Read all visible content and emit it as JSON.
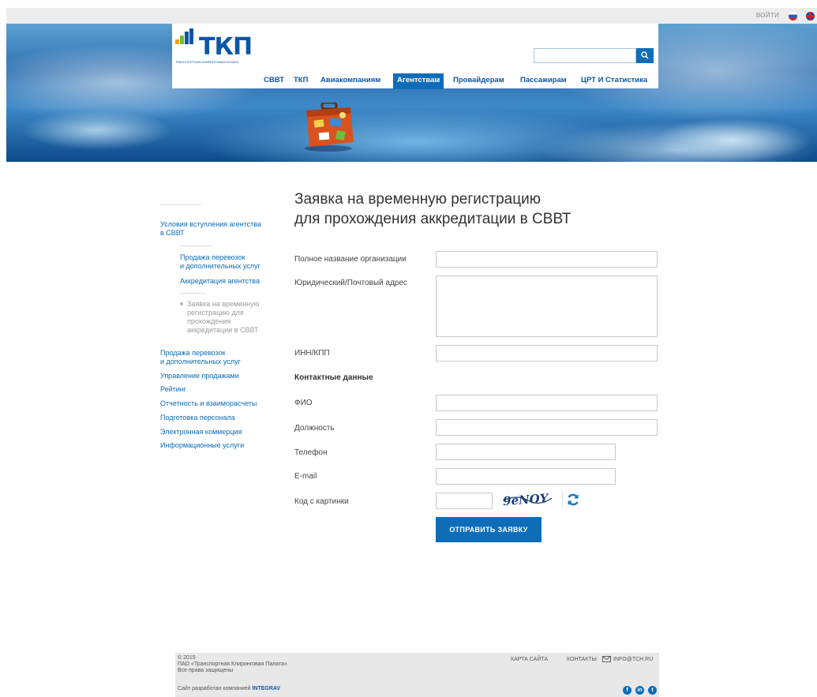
{
  "topbar": {
    "login": "войти"
  },
  "logo": {
    "text": "ТКП",
    "subtitle": "Транспортная Клиринговая Палата"
  },
  "nav": {
    "items": [
      "СВВТ",
      "ТКП",
      "Авиакомпаниям",
      "Агентствам",
      "Провайдерам",
      "Пассажирам",
      "ЦРТ И Статистика"
    ],
    "active": "Агентствам"
  },
  "sidebar": {
    "top_link": [
      "Условия вступления агентства",
      "в СВВТ"
    ],
    "sub1": [
      "Продажа перевозок",
      "и дополнительных услуг"
    ],
    "sub2": "Аккредитация агентства",
    "current": [
      "Заявка на временную",
      "регистрацию для",
      "прохождения",
      "аккредитации в СВВТ"
    ],
    "links": [
      [
        "Продажа перевозок",
        "и дополнительных услуг"
      ],
      [
        "Управление продажами"
      ],
      [
        "Рейтинг"
      ],
      [
        "Отчетность и взаиморасчеты"
      ],
      [
        "Подготовка персонала"
      ],
      [
        "Электронная коммерция"
      ],
      [
        "Информационные услуги"
      ]
    ]
  },
  "title": [
    "Заявка на временную регистрацию",
    "для прохождения аккредитации в СВВТ"
  ],
  "form": {
    "org_name": "Полное название организации",
    "address": "Юридический/Почтовый адрес",
    "inn": "ИНН/КПП",
    "contacts": "Контактные данные",
    "fio": "ФИО",
    "position": "Должность",
    "phone": "Телефон",
    "email": "E-mail",
    "captcha": "Код с картинки",
    "captcha_text": "9eNOY",
    "submit": "ОТПРАВИТЬ ЗАЯВКУ"
  },
  "footer": {
    "copy": [
      "© 2015",
      "ПАО «Транспортная Клиринговая Палата»",
      "Все права защищены"
    ],
    "dev_prefix": "Сайт разработан компанией",
    "dev_name": "INTEGRAV",
    "sitemap": "Карта сайта",
    "contacts": "Контакты",
    "email": "info@tch.ru"
  },
  "colors": {
    "brand": "#0c56a6",
    "accent": "#0f6db8",
    "link": "#0c6bb3"
  }
}
